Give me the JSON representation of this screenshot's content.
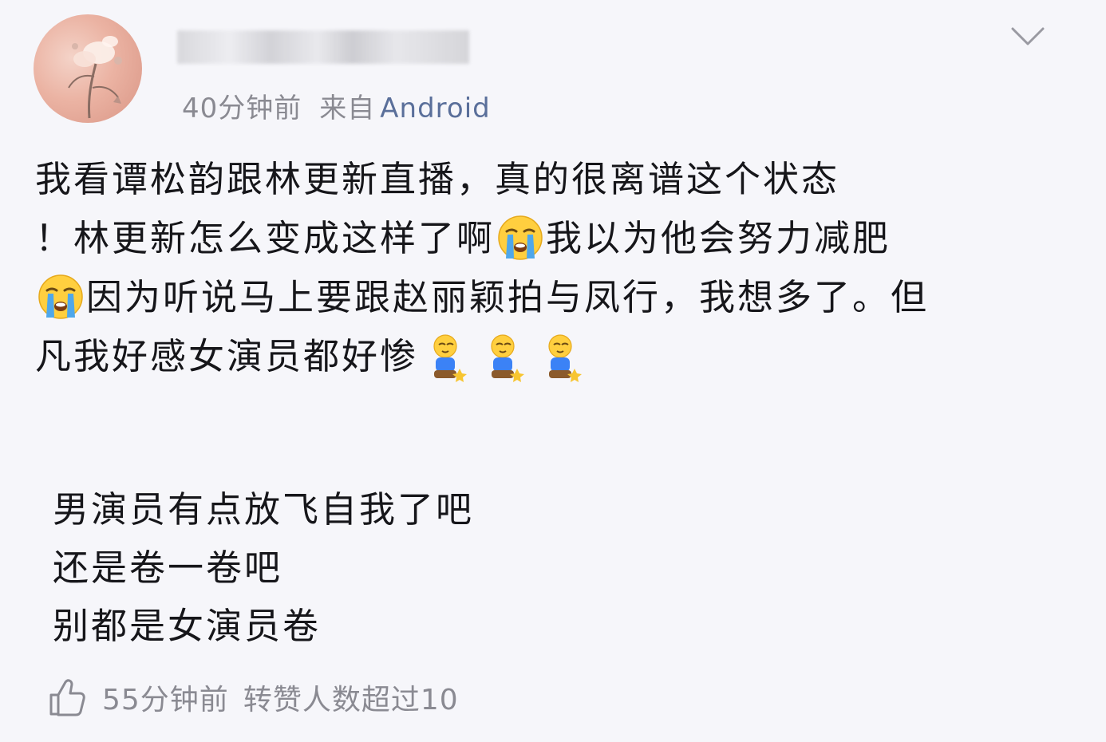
{
  "post": {
    "time": "40分钟前",
    "source_prefix": "来自",
    "source_device": "Android",
    "text_lines": [
      "我看谭松韵跟林更新直播，真的很离谱这个状态",
      "！林更新怎么变成这样了啊",
      "我以为他会努力减肥",
      "因为听说马上要跟赵丽颖拍与凤行，我想多了。但",
      "凡我好感女演员都好惨"
    ],
    "emoji": {
      "crying": "loudly-crying-face-icon",
      "kneeling": "kneeling-person-icon"
    }
  },
  "reply": {
    "lines": [
      "男演员有点放飞自我了吧",
      "还是卷一卷吧",
      "别都是女演员卷"
    ],
    "time": "55分钟前",
    "repost_note": "转赞人数超过10"
  },
  "colors": {
    "background": "#f6f6fa",
    "text": "#16161a",
    "meta": "#8a8a92",
    "source_link": "#5a6f9a"
  }
}
